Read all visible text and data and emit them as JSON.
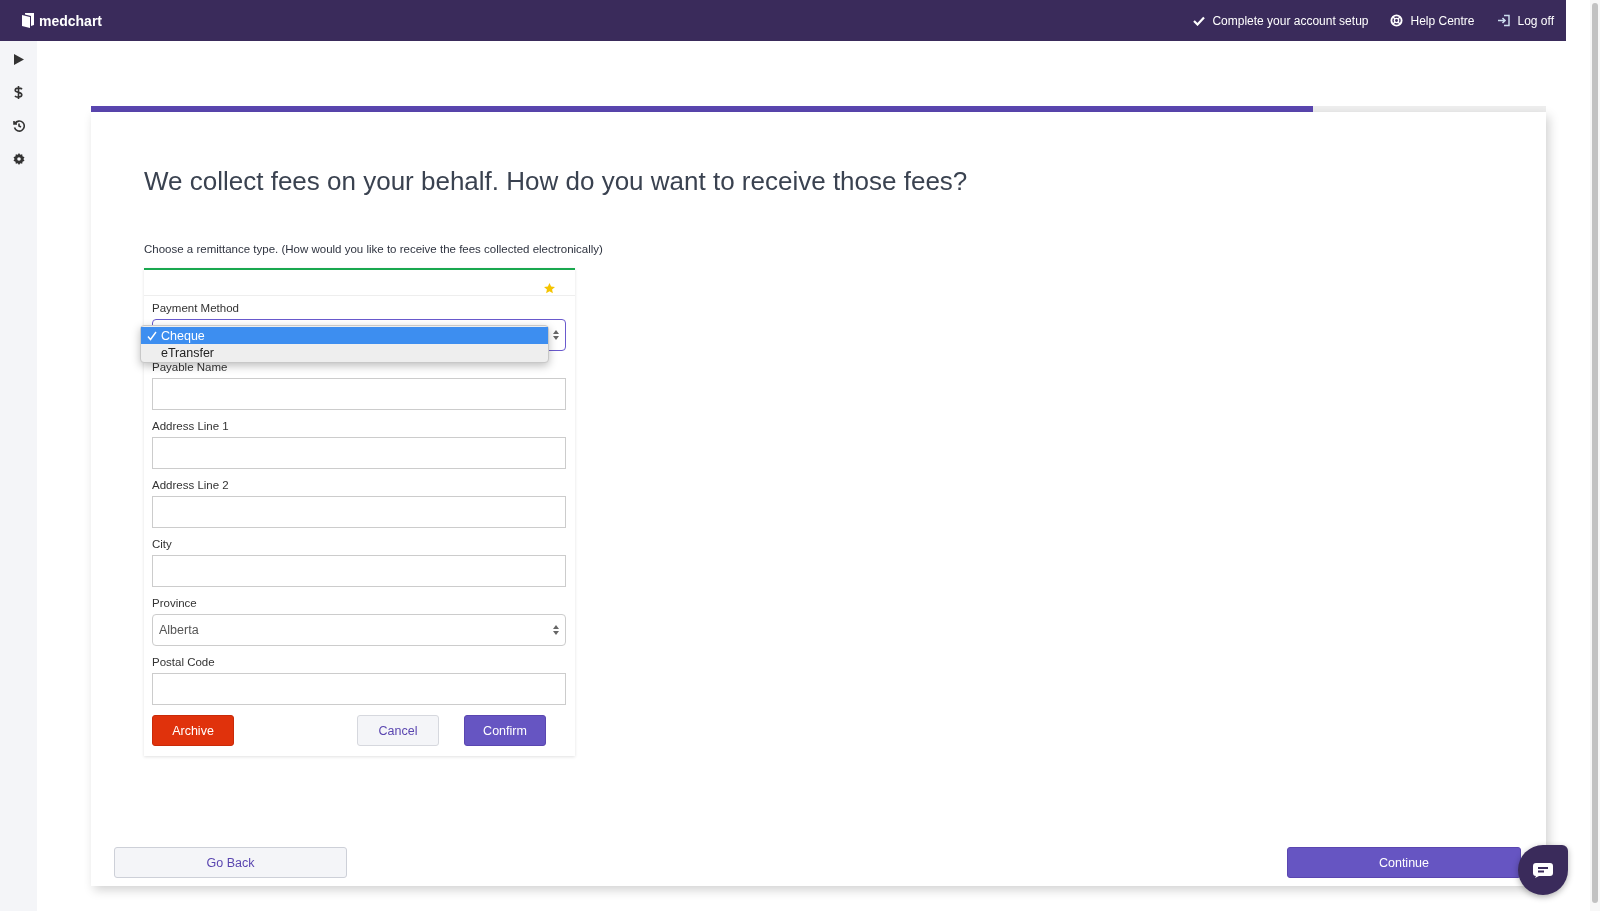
{
  "header": {
    "brand": "medchart",
    "links": [
      {
        "kind": "check",
        "label": "Complete your account setup"
      },
      {
        "kind": "help",
        "label": "Help Centre"
      },
      {
        "kind": "logout",
        "label": "Log off"
      }
    ]
  },
  "sidebar": {
    "items": [
      {
        "kind": "play"
      },
      {
        "kind": "dollar"
      },
      {
        "kind": "history"
      },
      {
        "kind": "settings"
      }
    ]
  },
  "progress": {
    "level": 0.84
  },
  "heading": "We collect fees on your behalf. How do you want to receive those fees?",
  "instruction": "Choose a remittance type. (How would you like to receive the fees collected electronically)",
  "form": {
    "payment_method": {
      "label": "Payment Method",
      "options": [
        {
          "label": "Cheque",
          "selected": true
        },
        {
          "label": "eTransfer",
          "selected": false
        }
      ]
    },
    "fields": [
      {
        "kind": "text",
        "label": "Payable Name"
      },
      {
        "kind": "text",
        "label": "Address Line 1"
      },
      {
        "kind": "text",
        "label": "Address Line 2"
      },
      {
        "kind": "text",
        "label": "City"
      },
      {
        "kind": "select",
        "label": "Province",
        "value": "Alberta"
      },
      {
        "kind": "text",
        "label": "Postal Code"
      }
    ],
    "buttons": [
      {
        "kind": "danger",
        "label": "Archive"
      },
      {
        "kind": "secondary",
        "label": "Cancel"
      },
      {
        "kind": "primary",
        "label": "Confirm"
      }
    ]
  },
  "footer": {
    "back": "Go Back",
    "next": "Continue"
  }
}
